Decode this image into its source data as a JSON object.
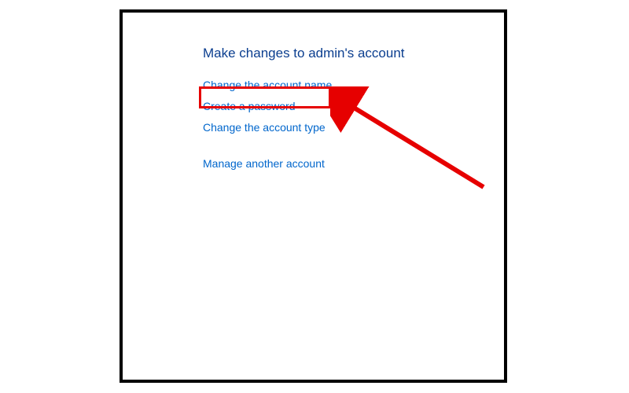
{
  "heading": "Make changes to admin's account",
  "links": {
    "change_name": "Change the account name",
    "create_password": "Create a password",
    "change_type": "Change the account type",
    "manage_another": "Manage another account"
  },
  "annotation": {
    "highlight_color": "#e60000",
    "arrow_color": "#e60000"
  }
}
